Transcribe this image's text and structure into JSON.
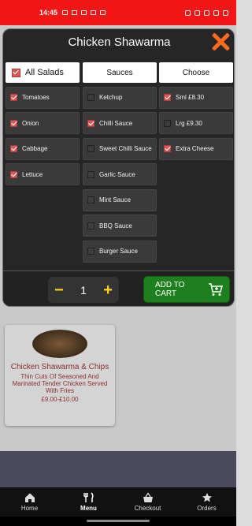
{
  "status_bar": {
    "time": "14:45"
  },
  "background_card": {
    "title": "Chicken Shawarma & Chips",
    "description": "Thin Cuts Of Seasoned And Marinated Tender Chicken Served With Fries",
    "price": "£9.00-£10.00"
  },
  "modal": {
    "title": "Chicken Shawarma",
    "columns": {
      "salads": {
        "header": "All Salads",
        "header_checked": true,
        "items": [
          {
            "label": "Tomatoes",
            "checked": true
          },
          {
            "label": "Onion",
            "checked": true
          },
          {
            "label": "Cabbage",
            "checked": true
          },
          {
            "label": "Lettuce",
            "checked": true
          }
        ]
      },
      "sauces": {
        "header": "Sauces",
        "items": [
          {
            "label": "Ketchup",
            "checked": false
          },
          {
            "label": "Chilli Sauce",
            "checked": true
          },
          {
            "label": "Sweet Chilli Sauce",
            "checked": false
          },
          {
            "label": "Garlic Sauce",
            "checked": false
          },
          {
            "label": "Mint Sauce",
            "checked": false
          },
          {
            "label": "BBQ Sauce",
            "checked": false
          },
          {
            "label": "Burger Sauce",
            "checked": false
          }
        ]
      },
      "choose": {
        "header": "Choose",
        "items": [
          {
            "label": "Sml £8.30",
            "checked": true
          },
          {
            "label": "Lrg £9.30",
            "checked": false
          },
          {
            "label": "Extra Cheese",
            "checked": true
          }
        ]
      }
    },
    "footer": {
      "quantity": "1",
      "minus": "−",
      "plus": "+",
      "add_to_cart": "ADD TO CART"
    }
  },
  "bottom_nav": {
    "items": [
      {
        "label": "Home",
        "icon": "home-icon"
      },
      {
        "label": "Menu",
        "icon": "cutlery-icon",
        "active": true
      },
      {
        "label": "Checkout",
        "icon": "basket-icon"
      },
      {
        "label": "Orders",
        "icon": "star-icon"
      }
    ]
  },
  "colors": {
    "status_bar": "#f21616",
    "accent_close": "#ff6a21",
    "add_to_cart": "#1d7f1d",
    "qty_controls": "#ffd21f",
    "checkbox_on": "#d95858"
  }
}
